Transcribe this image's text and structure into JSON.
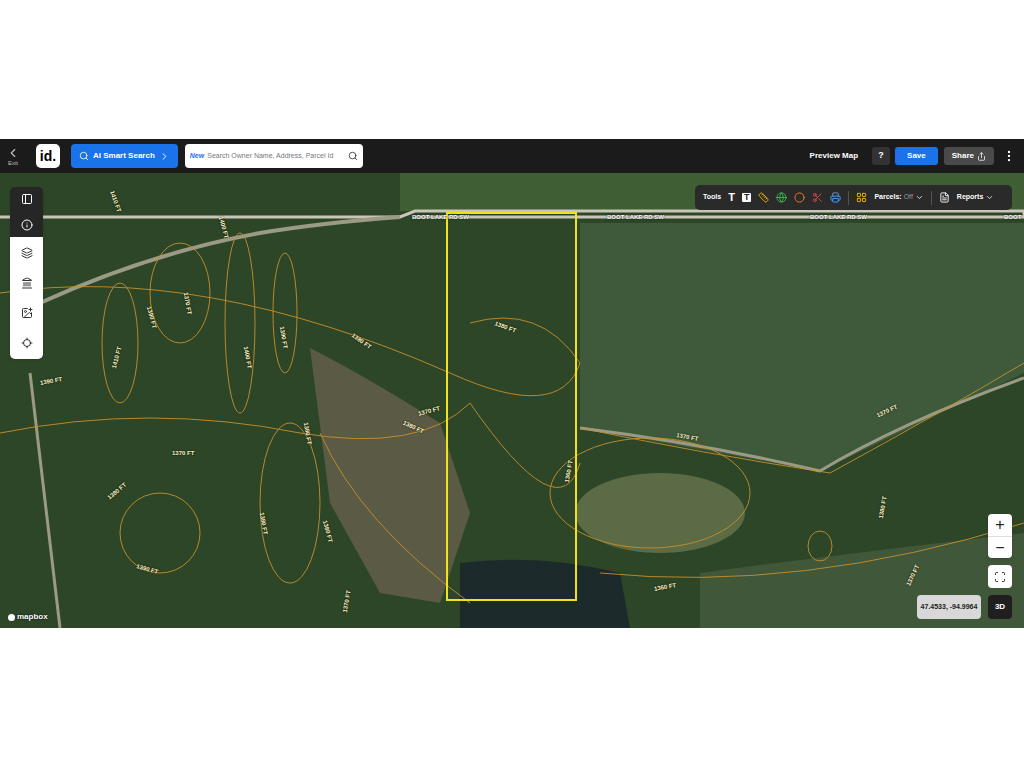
{
  "top_bar": {
    "exit": "Exit",
    "logo": "id.",
    "ai_search": "AI Smart Search",
    "search": {
      "badge": "New",
      "placeholder": "Search Owner Name, Address, Parcel Id"
    },
    "preview": "Preview Map",
    "help": "?",
    "save": "Save",
    "share": "Share"
  },
  "map_toolbar": {
    "tools": "Tools",
    "text_tools": [
      "T",
      "T"
    ],
    "parcels": "Parcels:",
    "parcels_state": "Off",
    "reports": "Reports"
  },
  "map": {
    "roads": [
      "BOOT LAKE RD SW",
      "BOOT LAKE RD SW",
      "BOOT LAKE RD SW",
      "BOOT"
    ],
    "contours": [
      "1410 FT",
      "1400 FT",
      "1390 FT",
      "1370 FT",
      "1410 FT",
      "1390 FT",
      "1400 FT",
      "1390 FT",
      "1380 FT",
      "1380 FT",
      "1370 FT",
      "1380 FT",
      "1370 FT",
      "1380 FT",
      "1380 FT",
      "1380 FT",
      "1380 FT",
      "1390 FT",
      "1370 FT",
      "1370 FT",
      "1370 FT",
      "1380 FT",
      "1360 FT",
      "1360 FT",
      "1370 FT"
    ],
    "attribution": "mapbox",
    "coordinates": "47.4533, -94.9964",
    "zoom": [
      "+",
      "−"
    ],
    "view": "3D"
  }
}
